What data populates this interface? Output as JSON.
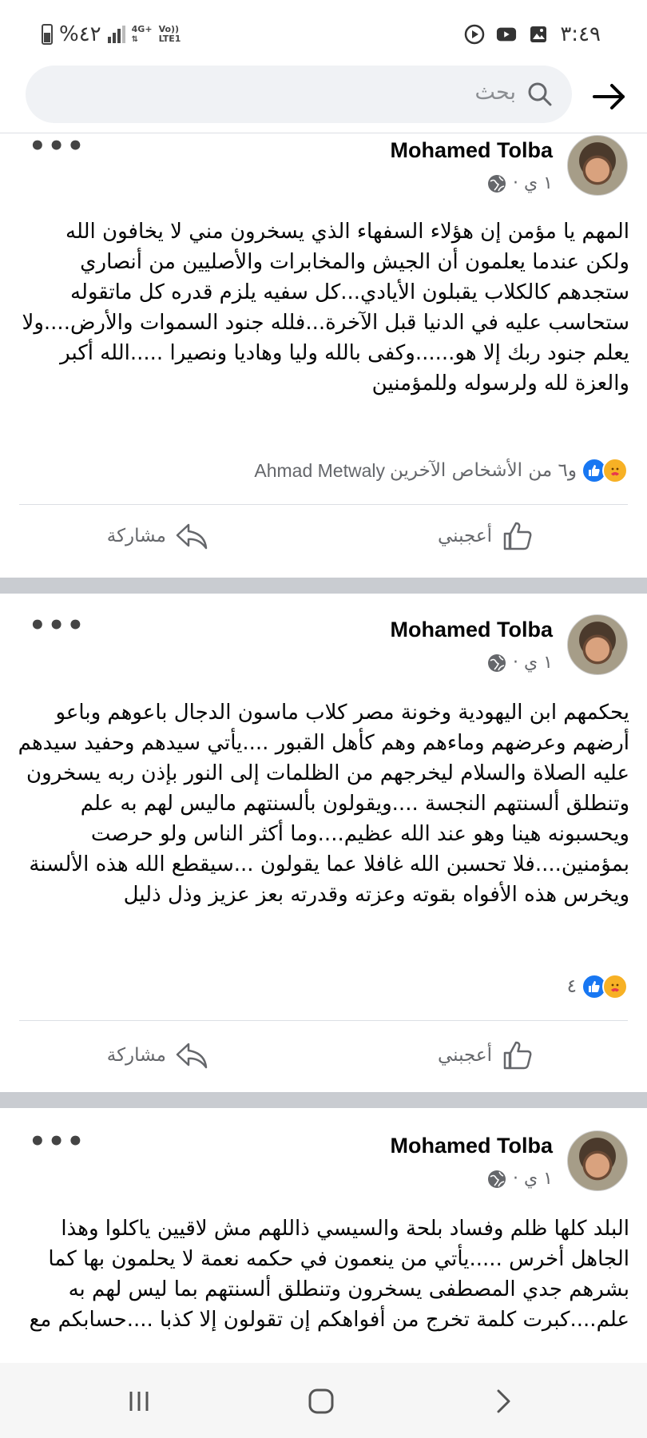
{
  "status_bar": {
    "time": "٣:٤٩",
    "battery_percent": "%٤٢",
    "network_top": "4G+",
    "network_bottom_1": "Vo))",
    "network_bottom_2": "LTE1"
  },
  "search": {
    "placeholder": "بحث"
  },
  "posts": [
    {
      "author": "Mohamed Tolba",
      "time": "١ ي ·",
      "text": "المهم يا مؤمن إن هؤلاء السفهاء الذي يسخرون مني لا يخافون الله ولكن عندما يعلمون أن الجيش والمخابرات والأصليين من أنصاري ستجدهم كالكلاب يقبلون الأيادي...كل سفيه يلزم قدره كل ماتقوله ستحاسب عليه في الدنيا قبل الآخرة...فلله جنود السموات والأرض....ولا يعلم جنود ربك إلا هو......وكفى بالله وليا وهاديا ونصيرا .....الله أكبر والعزة لله ولرسوله وللمؤمنين",
      "reactions_text": "و٦ من الأشخاص الآخرين",
      "reactions_name": "Ahmad Metwaly",
      "like_label": "أعجبني",
      "share_label": "مشاركة"
    },
    {
      "author": "Mohamed Tolba",
      "time": "١ ي ·",
      "text": "يحكمهم ابن اليهودية وخونة مصر كلاب ماسون الدجال باعوهم وباعو أرضهم وعرضهم وماءهم وهم كأهل القبور ....يأتي سيدهم وحفيد سيدهم عليه الصلاة والسلام ليخرجهم من الظلمات إلى النور بإذن ربه يسخرون وتنطلق ألسنتهم النجسة ....ويقولون بألسنتهم ماليس لهم به علم ويحسبونه هينا وهو عند الله عظيم....وما أكثر الناس ولو حرصت بمؤمنين....فلا تحسبن الله غافلا عما يقولون ...سيقطع الله هذه الألسنة ويخرس هذه الأفواه بقوته وعزته وقدرته بعز عزيز وذل ذليل",
      "reactions_count": "٤",
      "like_label": "أعجبني",
      "share_label": "مشاركة"
    },
    {
      "author": "Mohamed Tolba",
      "time": "١ ي ·",
      "text": "البلد كلها ظلم وفساد بلحة والسيسي ذاللهم مش لاقيين ياكلوا وهذا الجاهل أخرس .....يأتي من ينعمون في حكمه نعمة لا يحلمون بها كما بشرهم جدي المصطفى يسخرون وتنطلق ألسنتهم بما ليس لهم به علم....كبرت كلمة تخرج من أفواهكم إن تقولون إلا كذبا ....حسابكم مع"
    }
  ],
  "icons": {
    "back": "arrow-right-icon",
    "search": "search-icon",
    "globe": "globe-icon",
    "like": "thumbs-up-icon",
    "share": "share-arrow-icon",
    "more": "more-dots-icon"
  },
  "colors": {
    "accent": "#1877f2",
    "muted": "#65676b",
    "care": "#f7b125"
  }
}
